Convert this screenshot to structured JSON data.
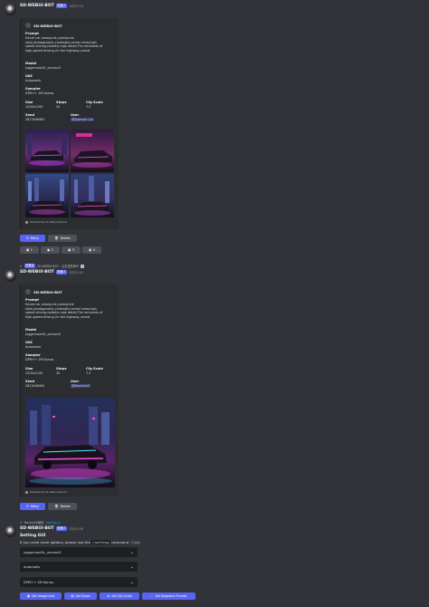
{
  "colors": {
    "background": "#313338",
    "embed": "#2b2d31",
    "blurple": "#5865f2",
    "secondary": "#4e5058",
    "select": "#1e1f22"
  },
  "message1": {
    "username": "SD-WEBUI-BOT",
    "app_tag": "机器人",
    "timestamp": "今天15:34",
    "embed_title": "SD-WEBUI-BOT",
    "prompt_label": "Prompt",
    "prompt_lines": [
      "future car,neonpunk,cyberpunk",
      "style,photographic,cinematic,center view,high",
      "speed driving,realistic,high detail,The remnants of",
      "high-speed driving,On the highway,unreal"
    ],
    "model_label": "Model",
    "model_value": "juggernautXL_version3",
    "vae_label": "VAE",
    "vae_value": "Automatic",
    "sampler_label": "Sampler",
    "sampler_value": "DPM++ 2M Karras",
    "size_label": "Size",
    "size_value": "1200x1200",
    "steps_label": "Steps",
    "steps_value": "20",
    "cfg_label": "Cfg Scale",
    "cfg_value": "7.5",
    "seed_label": "Seed",
    "seed_value": "2813406961",
    "user_label": "User",
    "user_value": "@Spenser Cai",
    "footer": "Powered by sd-webui-discord",
    "retry": "Retry",
    "delete": "Delete",
    "upscale_buttons": [
      "1",
      "2",
      "3",
      "4"
    ]
  },
  "message2": {
    "reply_user": "风格化",
    "reply_text": "SD-WEBUI-BOT : 点击查看命令",
    "username": "SD-WEBUI-BOT",
    "app_tag": "机器人",
    "timestamp": "今天15:35",
    "embed_title": "SD-WEBUI-BOT",
    "prompt_label": "Prompt",
    "prompt_lines": [
      "future car,neonpunk,cyberpunk",
      "style,photographic,cinematic,center view,high",
      "speed driving,realistic,high detail,The remnants of",
      "high-speed driving,On the highway,unreal"
    ],
    "model_label": "Model",
    "model_value": "juggernautXL_version3",
    "vae_label": "VAE",
    "vae_value": "Automatic",
    "sampler_label": "Sampler",
    "sampler_value": "DPM++ 2M Karras",
    "size_label": "Size",
    "size_value": "1200x1200",
    "steps_label": "Steps",
    "steps_value": "20",
    "cfg_label": "Cfg Scale",
    "cfg_value": "7.5",
    "seed_label": "Seed",
    "seed_value": "2813406961",
    "user_label": "User",
    "user_value": "@MachineS",
    "footer": "Powered by sd-webui-discord",
    "retry": "Retry",
    "delete": "Delete"
  },
  "message3": {
    "reply_user": "MachineS使用",
    "reply_cmd": "/setting_ui",
    "username": "SD-WEBUI-BOT",
    "app_tag": "机器人",
    "timestamp": "今天15:36",
    "title": "Setting GUI",
    "note_pre": "If you need more options, please use the",
    "note_cmd": "/setting",
    "note_post": "command",
    "note_suffix": "(已编辑)",
    "selects": [
      "juggernautXL_version3",
      "Automatic",
      "DPM++ 2M Karras"
    ],
    "buttons": [
      "Set Image size",
      "Set Steps",
      "Set Cfg Scale",
      "Set Negative Prompt"
    ]
  }
}
